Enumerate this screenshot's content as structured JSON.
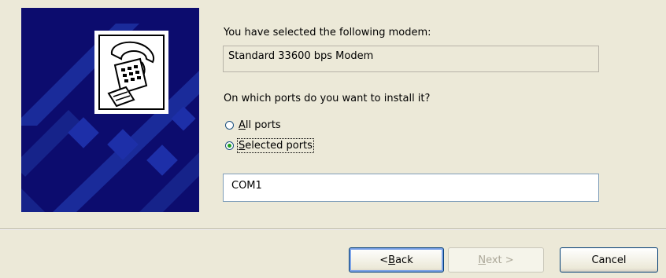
{
  "header": {
    "selected_modem_prompt": "You have selected the following modem:",
    "modem_name": "Standard 33600 bps Modem",
    "ports_question": "On which ports do you want to install it?"
  },
  "ports": {
    "options": [
      {
        "label_prefix": "",
        "label_accel": "A",
        "label_rest": "ll ports",
        "selected": false
      },
      {
        "label_prefix": "",
        "label_accel": "S",
        "label_rest": "elected ports",
        "selected": true
      }
    ],
    "list": [
      "COM1"
    ]
  },
  "buttons": {
    "back_accel": "B",
    "back_rest": "ack",
    "back_prefix": "< ",
    "next_accel": "N",
    "next_rest": "ext >",
    "cancel": "Cancel"
  },
  "icons": {
    "banner": "telephone-modem-icon"
  },
  "colors": {
    "banner_bg": "#0c0c6e",
    "dialog_bg": "#ece9d8",
    "radio_dot": "#21a121"
  }
}
